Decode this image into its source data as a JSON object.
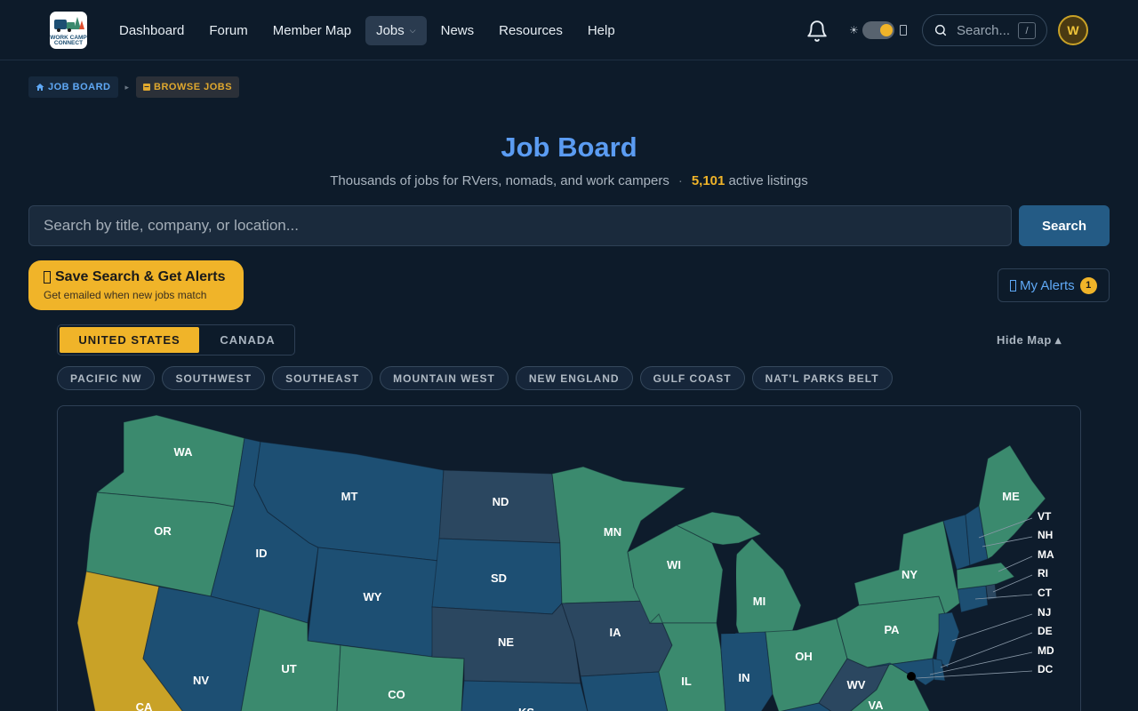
{
  "colors": {
    "background": "#0d1b2a",
    "accent": "#f0b429",
    "link": "#5b9cf2",
    "green": "#3b8a6e",
    "blue": "#1d4f73",
    "slate": "#2b4760",
    "gold": "#c9a227"
  },
  "header": {
    "logo_text": "WORK CAMP CONNECT",
    "nav": [
      {
        "label": "Dashboard"
      },
      {
        "label": "Forum"
      },
      {
        "label": "Member Map"
      },
      {
        "label": "Jobs"
      },
      {
        "label": "News"
      },
      {
        "label": "Resources"
      },
      {
        "label": "Help"
      }
    ],
    "search_placeholder": "Search...",
    "search_shortcut": "/",
    "avatar_initial": "W"
  },
  "breadcrumb": {
    "home": "JOB BOARD",
    "current": "BROWSE JOBS"
  },
  "page": {
    "title": "Job Board",
    "subtitle": "Thousands of jobs for RVers, nomads, and work campers",
    "separator": "·",
    "listing_count": "5,101",
    "listing_suffix": "active listings",
    "search_placeholder": "Search by title, company, or location...",
    "search_button": "Search",
    "save_search_title": "Save Search & Get Alerts",
    "save_search_sub": "Get emailed when new jobs match",
    "alerts_label": "My Alerts",
    "alerts_count": "1"
  },
  "map": {
    "tabs": [
      "UNITED STATES",
      "CANADA"
    ],
    "active_tab": "UNITED STATES",
    "hide_label": "Hide Map ▴",
    "regions": [
      "PACIFIC NW",
      "SOUTHWEST",
      "SOUTHEAST",
      "MOUNTAIN WEST",
      "NEW ENGLAND",
      "GULF COAST",
      "NAT'L PARKS BELT"
    ],
    "states": [
      "WA",
      "OR",
      "CA",
      "ID",
      "NV",
      "MT",
      "WY",
      "UT",
      "CO",
      "ND",
      "SD",
      "NE",
      "KS",
      "MN",
      "IA",
      "WI",
      "IL",
      "MI",
      "IN",
      "OH",
      "WV",
      "VA",
      "PA",
      "NY",
      "ME"
    ],
    "small_states": [
      "VT",
      "NH",
      "MA",
      "RI",
      "CT",
      "NJ",
      "DE",
      "MD",
      "DC"
    ]
  }
}
